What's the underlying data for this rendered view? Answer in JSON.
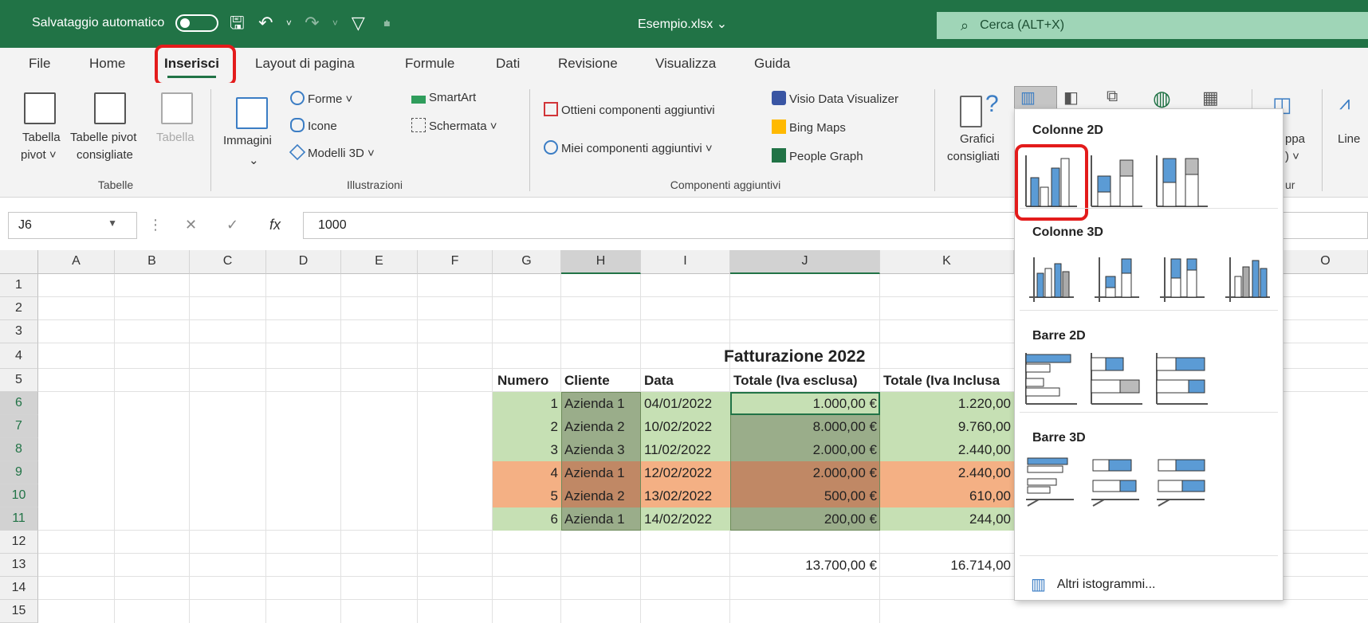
{
  "titlebar": {
    "autosave_label": "Salvataggio automatico",
    "filename": "Esempio.xlsx",
    "filename_arrow": "⌄",
    "search_placeholder": "Cerca (ALT+X)"
  },
  "tabs": [
    "File",
    "Home",
    "Inserisci",
    "Layout di pagina",
    "Formule",
    "Dati",
    "Revisione",
    "Visualizza",
    "Guida"
  ],
  "active_tab": "Inserisci",
  "ribbon": {
    "tabelle": {
      "pivot_label_1": "Tabella",
      "pivot_label_2": "pivot ˅",
      "recpivot_label_1": "Tabelle pivot",
      "recpivot_label_2": "consigliate",
      "table_label": "Tabella",
      "group": "Tabelle"
    },
    "illustrazioni": {
      "images_label": "Immagini",
      "images_arrow": "⌄",
      "shapes_label": "Forme ˅",
      "icons_label": "Icone",
      "models_label": "Modelli 3D ˅",
      "smartart_label": "SmartArt",
      "screenshot_label": "Schermata ˅",
      "group": "Illustrazioni"
    },
    "componenti": {
      "get_addins_label": "Ottieni componenti aggiuntivi",
      "my_addins_label": "Miei componenti aggiuntivi ˅",
      "visio_label": "Visio Data Visualizer",
      "bing_label": "Bing Maps",
      "people_label": "People Graph",
      "group": "Componenti aggiuntivi"
    },
    "grafici": {
      "recommended_label_1": "Grafici",
      "recommended_label_2": "consigliati",
      "map_label_1": "ppa",
      "map_label_2": ") ˅",
      "line_label": "Line",
      "group_partial": "ur"
    }
  },
  "formula_bar": {
    "name_box": "J6",
    "fx_label": "fx",
    "value": "1000"
  },
  "columns": [
    "A",
    "B",
    "C",
    "D",
    "E",
    "F",
    "G",
    "H",
    "I",
    "J",
    "K",
    "O"
  ],
  "rows": [
    "1",
    "2",
    "3",
    "4",
    "5",
    "6",
    "7",
    "8",
    "9",
    "10",
    "11",
    "12",
    "13",
    "14",
    "15"
  ],
  "table": {
    "title": "Fatturazione 2022",
    "headers": [
      "Numero",
      "Cliente",
      "Data",
      "Totale (Iva esclusa)",
      "Totale (Iva Inclusa"
    ],
    "rows": [
      [
        "1",
        "Azienda 1",
        "04/01/2022",
        "1.000,00 €",
        "1.220,00"
      ],
      [
        "2",
        "Azienda 2",
        "10/02/2022",
        "8.000,00 €",
        "9.760,00"
      ],
      [
        "3",
        "Azienda 3",
        "11/02/2022",
        "2.000,00 €",
        "2.440,00"
      ],
      [
        "4",
        "Azienda 1",
        "12/02/2022",
        "2.000,00 €",
        "2.440,00"
      ],
      [
        "5",
        "Azienda 2",
        "13/02/2022",
        "500,00 €",
        "610,00"
      ],
      [
        "6",
        "Azienda 1",
        "14/02/2022",
        "200,00 €",
        "244,00"
      ]
    ],
    "total_excl": "13.700,00 €",
    "total_incl": "16.714,00"
  },
  "colors": {
    "green_fill": "#c6e0b4",
    "green_sel": "#9aad8a",
    "orange_fill": "#f4b084",
    "orange_sel": "#c08865",
    "excel_green": "#217346",
    "highlight_red": "#e31b1b"
  },
  "dropdown": {
    "section_1": "Colonne 2D",
    "section_2": "Colonne 3D",
    "section_3": "Barre 2D",
    "section_4": "Barre 3D",
    "more_label": "Altri istogrammi..."
  }
}
